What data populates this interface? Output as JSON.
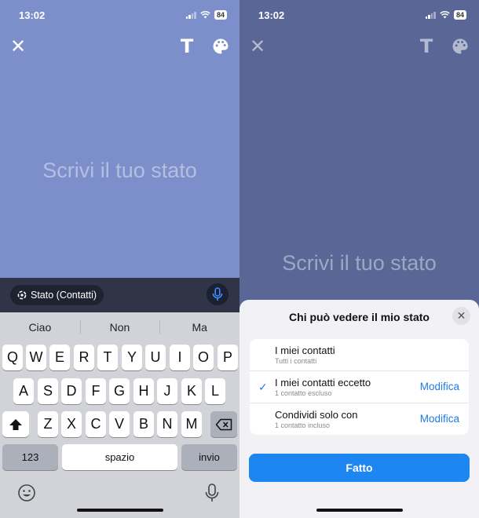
{
  "status_bar": {
    "time": "13:02",
    "battery": "84"
  },
  "editor": {
    "placeholder": "Scrivi il tuo stato",
    "icons": {
      "close": "close-icon",
      "text": "text-style-icon",
      "palette": "palette-icon"
    }
  },
  "audience_chip": {
    "label": "Stato (Contatti)"
  },
  "keyboard": {
    "suggestions": [
      "Ciao",
      "Non",
      "Ma"
    ],
    "row1": [
      "Q",
      "W",
      "E",
      "R",
      "T",
      "Y",
      "U",
      "I",
      "O",
      "P"
    ],
    "row2": [
      "A",
      "S",
      "D",
      "F",
      "G",
      "H",
      "J",
      "K",
      "L"
    ],
    "row3": [
      "Z",
      "X",
      "C",
      "V",
      "B",
      "N",
      "M"
    ],
    "numbers_label": "123",
    "space_label": "spazio",
    "return_label": "invio"
  },
  "sheet": {
    "title": "Chi può vedere il mio stato",
    "options": [
      {
        "title": "I miei contatti",
        "subtitle": "Tutti i contatti",
        "edit": "",
        "selected": false
      },
      {
        "title": "I miei contatti eccetto",
        "subtitle": "1 contatto escluso",
        "edit": "Modifica",
        "selected": true
      },
      {
        "title": "Condividi solo con",
        "subtitle": "1 contatto incluso",
        "edit": "Modifica",
        "selected": false
      }
    ],
    "done_label": "Fatto"
  },
  "colors": {
    "left_background": "#7d8fcb",
    "right_background": "#5a6796",
    "accent": "#1e86f0"
  }
}
